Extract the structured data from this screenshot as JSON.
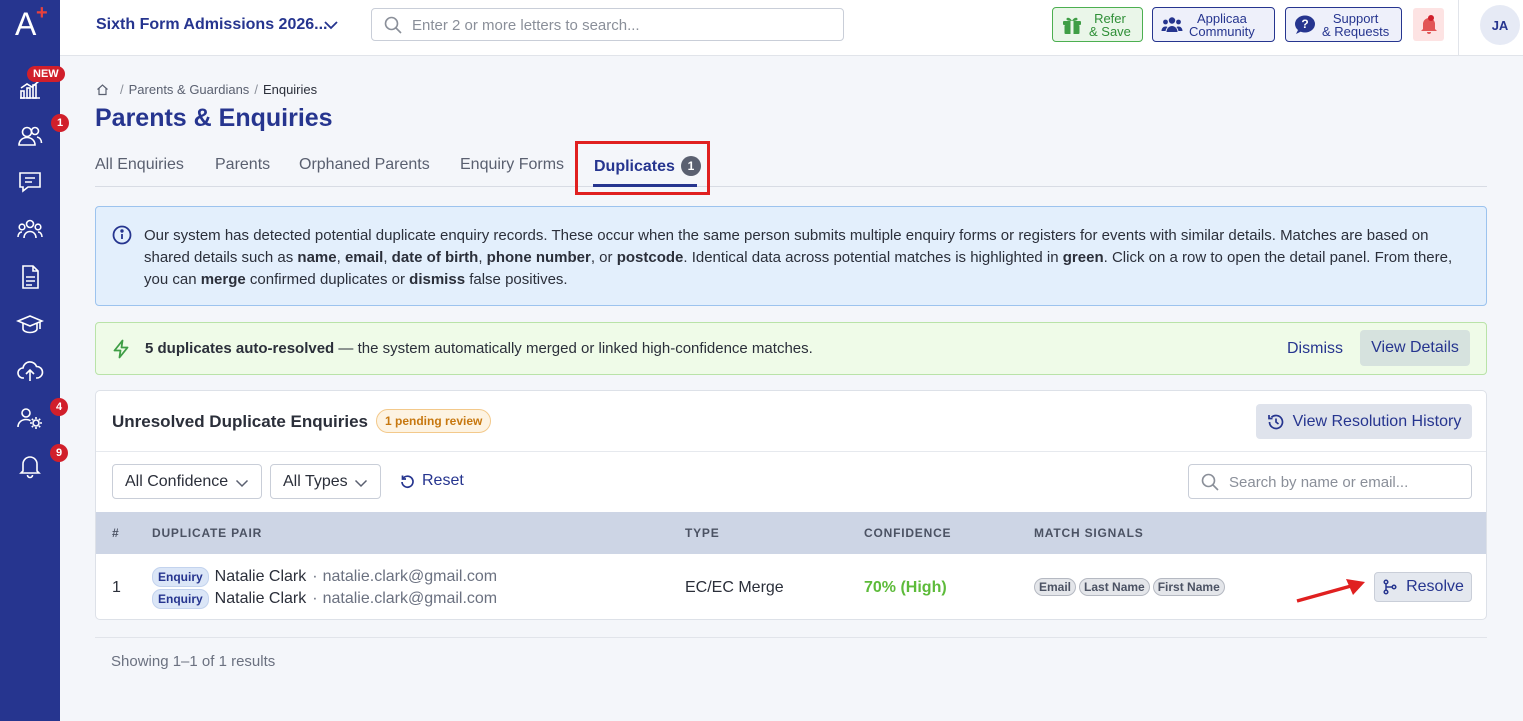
{
  "app": {
    "title": "Sixth Form Admissions 2026...",
    "search_placeholder": "Enter 2 or more letters to search...",
    "refer_line1": "Refer",
    "refer_line2": "& Save",
    "community_line1": "Applicaa",
    "community_line2": "Community",
    "support_line1": "Support",
    "support_line2": "& Requests",
    "avatar_initials": "JA",
    "brand_color": "#26358f"
  },
  "sidebar": {
    "new_badge": "NEW",
    "items": [
      {
        "icon": "analytics-icon",
        "badge": ""
      },
      {
        "icon": "users-icon",
        "badge": "1"
      },
      {
        "icon": "messages-icon",
        "badge": ""
      },
      {
        "icon": "group-icon",
        "badge": ""
      },
      {
        "icon": "document-icon",
        "badge": ""
      },
      {
        "icon": "graduation-cap-icon",
        "badge": ""
      },
      {
        "icon": "cloud-upload-icon",
        "badge": ""
      },
      {
        "icon": "user-settings-icon",
        "badge": "4"
      },
      {
        "icon": "bell-icon",
        "badge": "9"
      }
    ]
  },
  "breadcrumb": {
    "parent": "Parents & Guardians",
    "current": "Enquiries"
  },
  "page": {
    "title": "Parents & Enquiries"
  },
  "tabs": [
    {
      "label": "All Enquiries"
    },
    {
      "label": "Parents"
    },
    {
      "label": "Orphaned Parents"
    },
    {
      "label": "Enquiry Forms"
    },
    {
      "label": "Duplicates",
      "count": "1",
      "active": true
    }
  ],
  "info": {
    "t1": "Our system has detected potential duplicate enquiry records. These occur when the same person submits multiple enquiry forms or registers for events with similar details. Matches are based on shared details such as ",
    "b1": "name",
    "t2": ", ",
    "b2": "email",
    "t3": ", ",
    "b3": "date of birth",
    "t4": ", ",
    "b4": "phone number",
    "t5": ", or ",
    "b5": "postcode",
    "t6": ". Identical data across potential matches is highlighted in ",
    "b6": "green",
    "t7": ". Click on a row to open the detail panel. From there, you can ",
    "b7": "merge",
    "t8": " confirmed duplicates or ",
    "b8": "dismiss",
    "t9": " false positives."
  },
  "auto_resolved": {
    "bold": "5 duplicates auto-resolved",
    "text": " — the system automatically merged or linked high-confidence matches.",
    "dismiss": "Dismiss",
    "view_details": "View Details"
  },
  "card": {
    "title": "Unresolved Duplicate Enquiries",
    "pending": "1 pending review",
    "history_button": "View Resolution History",
    "filter_confidence": "All Confidence",
    "filter_types": "All Types",
    "reset": "Reset",
    "search_placeholder": "Search by name or email...",
    "columns": [
      "#",
      "DUPLICATE PAIR",
      "TYPE",
      "CONFIDENCE",
      "MATCH SIGNALS"
    ],
    "rows": [
      {
        "index": "1",
        "pair": [
          {
            "tag": "Enquiry",
            "name": "Natalie Clark",
            "sep": "·",
            "email": "natalie.clark@gmail.com"
          },
          {
            "tag": "Enquiry",
            "name": "Natalie Clark",
            "sep": "·",
            "email": "natalie.clark@gmail.com"
          }
        ],
        "type": "EC/EC Merge",
        "confidence": "70% (High)",
        "signals": [
          "Email",
          "Last Name",
          "First Name"
        ],
        "action": "Resolve"
      }
    ],
    "results": "Showing 1–1 of 1 results"
  }
}
